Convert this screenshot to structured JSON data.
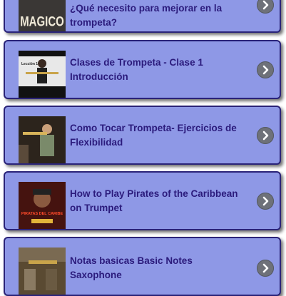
{
  "videos": [
    {
      "title": "¿Qué necesito para mejorar en la trompeta?",
      "thumbnail_icon": "magico-thumbnail",
      "thumb_text": "MAGICO"
    },
    {
      "title": "Clases de Trompeta - Clase 1 Introducción",
      "thumbnail_icon": "trumpet-lesson-thumbnail",
      "thumb_text": "Lección 1"
    },
    {
      "title": "Como Tocar Trompeta- Ejercicios de Flexibilidad",
      "thumbnail_icon": "trumpet-player-thumbnail"
    },
    {
      "title": "How to Play Pirates of the Caribbean on Trumpet",
      "thumbnail_icon": "pirates-thumbnail",
      "thumb_text": "PIRATAS DEL CARIBE"
    },
    {
      "title": "Notas basicas Basic Notes Saxophone",
      "thumbnail_icon": "saxophone-thumbnail"
    }
  ],
  "colors": {
    "card_bg": "#8e98e6",
    "card_border": "#2a2378",
    "title_text": "#2b1b7c",
    "chevron_bg": "#6e7179"
  }
}
